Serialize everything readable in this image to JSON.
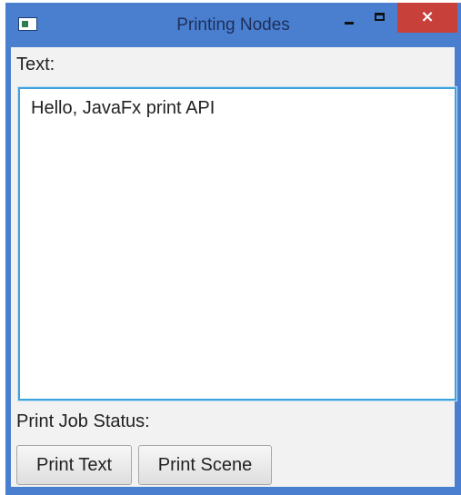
{
  "window": {
    "title": "Printing Nodes",
    "close_glyph": "×",
    "icons": {
      "app": "app-icon",
      "minimize": "minimize-icon",
      "maximize": "maximize-icon",
      "close": "close-icon"
    },
    "colors": {
      "frame": "#4a7fcf",
      "close": "#c8403a",
      "focus_border": "#3ea3dc"
    }
  },
  "form": {
    "text_label": "Text:",
    "text_value": "Hello, JavaFx print API",
    "status_label": "Print Job Status:",
    "print_text_button": "Print Text",
    "print_scene_button": "Print Scene"
  }
}
